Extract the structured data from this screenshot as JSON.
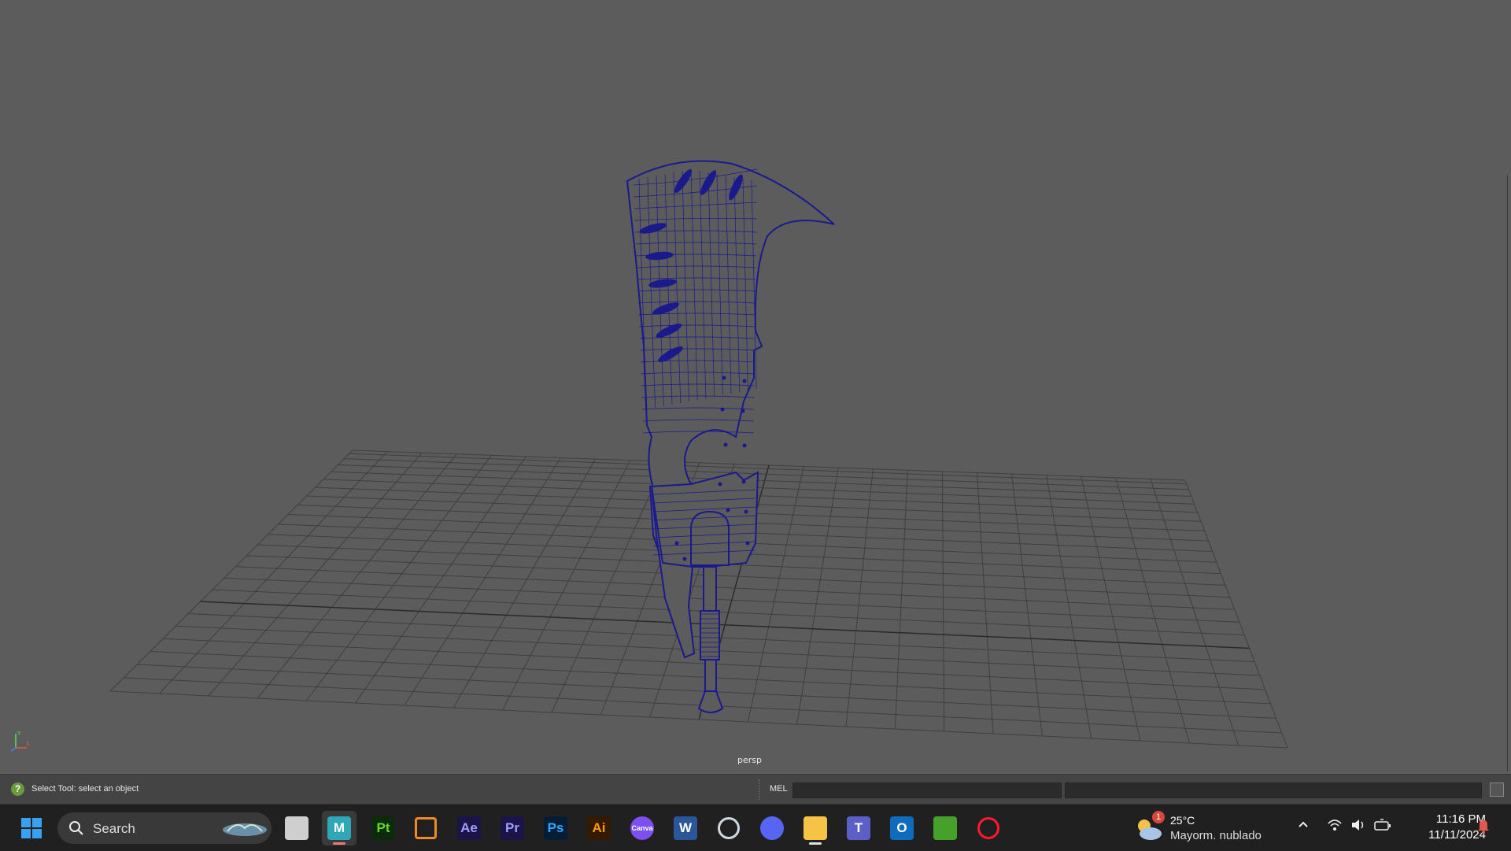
{
  "viewport": {
    "camera_label": "persp",
    "axis_y_label": "Y",
    "axis_x_label": "X",
    "wire_color": "#1a1a8c"
  },
  "statusbar": {
    "help_line": "Select Tool: select an object",
    "script_type": "MEL",
    "command_value": "",
    "result_value": ""
  },
  "taskbar": {
    "search_placeholder": "Search",
    "apps": [
      {
        "name": "file-explorer-window",
        "label": ""
      },
      {
        "name": "maya",
        "label": "M"
      },
      {
        "name": "painter",
        "label": "Pt"
      },
      {
        "name": "blender",
        "label": ""
      },
      {
        "name": "after-effects",
        "label": "Ae"
      },
      {
        "name": "premiere",
        "label": "Pr"
      },
      {
        "name": "photoshop",
        "label": "Ps"
      },
      {
        "name": "illustrator",
        "label": "Ai"
      },
      {
        "name": "canva",
        "label": "Canva"
      },
      {
        "name": "word",
        "label": "W"
      },
      {
        "name": "steam",
        "label": ""
      },
      {
        "name": "discord",
        "label": ""
      },
      {
        "name": "file-explorer",
        "label": ""
      },
      {
        "name": "teams",
        "label": "T"
      },
      {
        "name": "outlook",
        "label": "O"
      },
      {
        "name": "minecraft",
        "label": ""
      },
      {
        "name": "opera",
        "label": ""
      }
    ],
    "weather": {
      "badge": "1",
      "temperature": "25°C",
      "condition": "Mayorm. nublado"
    },
    "clock": {
      "time": "11:16 PM",
      "date": "11/11/2024"
    }
  }
}
